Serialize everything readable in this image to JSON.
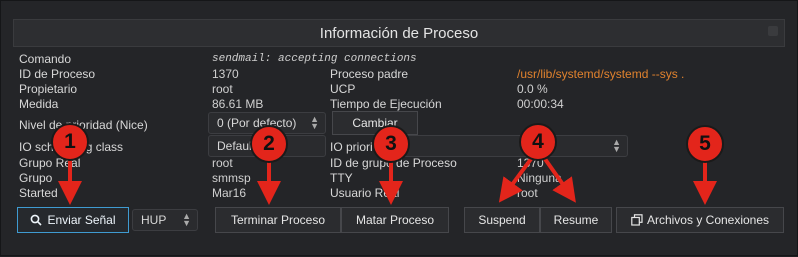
{
  "window": {
    "title": "Información de Proceso"
  },
  "info": {
    "command_label": "Comando",
    "command_value": "sendmail: accepting connections",
    "pid_label": "ID de Proceso",
    "pid_value": "1370",
    "parent_label": "Proceso padre",
    "parent_value": "/usr/lib/systemd/systemd --sys .",
    "owner_label": "Propietario",
    "owner_value": "root",
    "ucp_label": "UCP",
    "ucp_value": "0.0 %",
    "size_label": "Medida",
    "size_value": "86.61 MB",
    "exec_label": "Tiempo de Ejecución",
    "exec_value": "00:00:34",
    "nice_label": "Nivel de prioridad (Nice)",
    "nice_value": "0 (Por defecto)",
    "change_button": "Cambiar",
    "io_sched_label": "IO scheduling class",
    "io_sched_value": "Default",
    "io_prio_label": "IO priority",
    "group_real_label": "Grupo Real",
    "group_real_value": "root",
    "group_id_label": "ID de grupo de Proceso",
    "group_id_value": "1370",
    "group_label": "Grupo",
    "group_value": "smmsp",
    "tty_label": "TTY",
    "tty_value": "Ninguna",
    "started_label": "Started",
    "started_value": "Mar16",
    "user_real_label": "Usuario Real",
    "user_real_value": "root"
  },
  "actions": {
    "send_signal": "Enviar Señal",
    "signal_value": "HUP",
    "terminate": "Terminar Proceso",
    "kill": "Matar Proceso",
    "suspend": "Suspend",
    "resume": "Resume",
    "files": "Archivos y Conexiones"
  },
  "annotations": [
    "1",
    "2",
    "3",
    "4",
    "5"
  ],
  "colors": {
    "badge": "#e3251b",
    "accent": "#3f9bd1",
    "path": "#e0822e"
  }
}
